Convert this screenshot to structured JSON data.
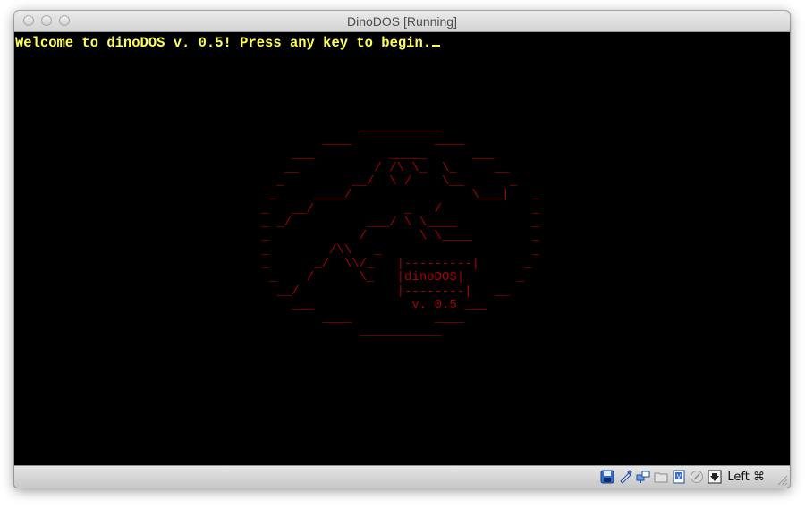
{
  "window": {
    "title": "DinoDOS [Running]"
  },
  "console": {
    "welcome_message": "Welcome to dinoDOS v. 0.5! Press any key to begin.",
    "ascii_art": "              ___________\n         ____           ____\n     ___          _____      ___\n    __          / /\\ \\_  \\_     __\n   _         __/  \\ /    \\__      _\n  _     ____/                \\___|   _\n _   __/            _   /            _\n _ _/          ___/ \\ \\____          _\n _            /       \\ \\____        _\n _        /\\\\   _                    _\n _      _/  \\\\/_   |---------|      _\n  _    /      \\_   |dinoDOS|       _\n   __/             |--------|   __\n     ___             v. 0.5 ___\n         ____           ____\n              ___________",
    "text_color": "#ffff55",
    "art_color": "#a80000",
    "background_color": "#000000"
  },
  "statusbar": {
    "host_key_label": "Left ⌘",
    "icons": [
      "hard-disk-icon",
      "optical-drive-icon",
      "network-icon",
      "shared-folder-icon",
      "display-icon",
      "capture-icon",
      "mouse-integration-icon"
    ]
  }
}
